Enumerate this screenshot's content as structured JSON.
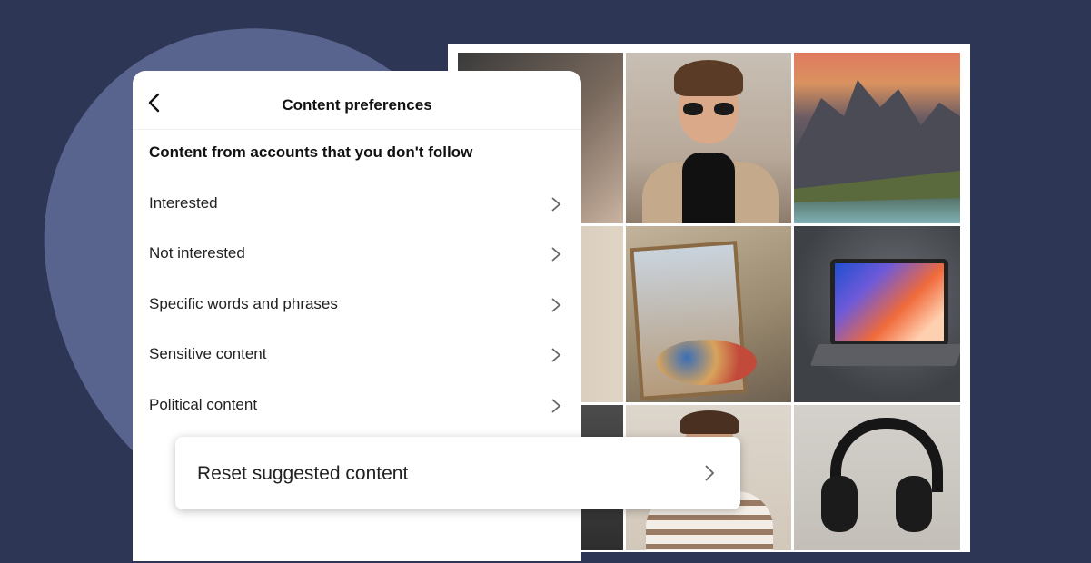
{
  "panel": {
    "title": "Content preferences",
    "back_icon": "chevron-left-icon",
    "section_title": "Content from accounts that you don't follow",
    "items": [
      {
        "label": "Interested",
        "icon": "chevron-right-icon"
      },
      {
        "label": "Not interested",
        "icon": "chevron-right-icon"
      },
      {
        "label": "Specific words and phrases",
        "icon": "chevron-right-icon"
      },
      {
        "label": "Sensitive content",
        "icon": "chevron-right-icon"
      },
      {
        "label": "Political content",
        "icon": "chevron-right-icon"
      }
    ]
  },
  "reset_card": {
    "label": "Reset suggested content",
    "icon": "chevron-right-icon"
  },
  "colors": {
    "background": "#2e3656",
    "blob": "#59648e",
    "panel": "#ffffff",
    "text": "#222222"
  }
}
